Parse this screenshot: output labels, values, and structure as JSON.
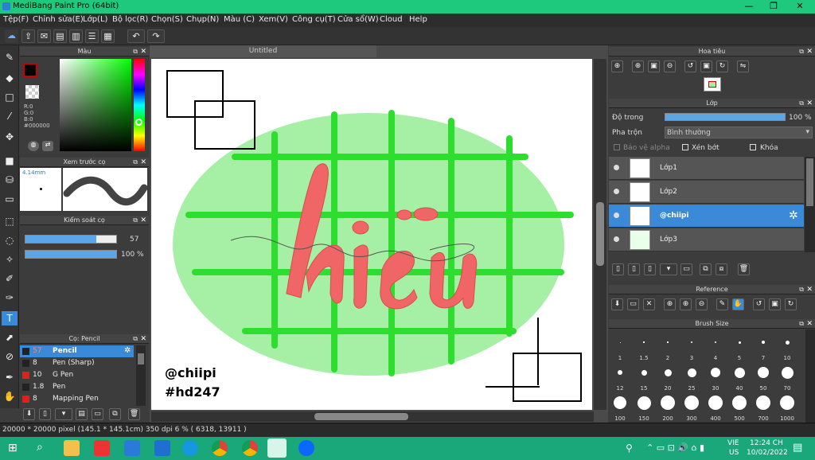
{
  "window": {
    "title": "MediBang Paint Pro (64bit)",
    "minimize": "—",
    "restore": "❐",
    "close": "✕"
  },
  "menu": [
    "Tệp(F)",
    "Chỉnh sửa(E)",
    "Lớp(L)",
    "Bộ lọc(R)",
    "Chọn(S)",
    "Chụp(N)",
    "Màu (C)",
    "Xem(V)",
    "Công cụ(T)",
    "Cửa sổ(W)",
    "Cloud",
    "Help"
  ],
  "color_panel": {
    "title": "Màu",
    "r": "R:0",
    "g": "G:0",
    "b": "B:0",
    "hex": "#000000",
    "primary": "#000000",
    "secondary": "#ff0000"
  },
  "preview_panel": {
    "title": "Xem trước cọ",
    "size": "4.14mm"
  },
  "brush_control": {
    "title": "Kiểm soát cọ",
    "size_value": "57",
    "opacity_value": "100 %",
    "size_fraction": 0.78,
    "opacity_fraction": 1.0
  },
  "brush_list": {
    "title": "Cọ: Pencil",
    "items": [
      {
        "size": "57",
        "name": "Pencil",
        "color": "#222222",
        "selected": true
      },
      {
        "size": "8",
        "name": "Pen (Sharp)",
        "color": "#222222",
        "selected": false
      },
      {
        "size": "10",
        "name": "G Pen",
        "color": "#e02020",
        "selected": false
      },
      {
        "size": "1.8",
        "name": "Pen",
        "color": "#222222",
        "selected": false
      },
      {
        "size": "8",
        "name": "Mapping Pen",
        "color": "#e02020",
        "selected": false
      }
    ]
  },
  "document": {
    "tab": "Untitled",
    "watermark_line1": "@chiipi",
    "watermark_line2": "#hd247"
  },
  "navigator": {
    "title": "Hoa tiêu"
  },
  "layer_panel": {
    "title": "Lớp",
    "opacity_label": "Độ trong",
    "opacity_value": "100 %",
    "blend_label": "Pha trộn",
    "blend_value": "Bình thường",
    "protect_alpha": "Bảo vệ alpha",
    "clipping": "Xén bớt",
    "lock": "Khóa",
    "layers": [
      {
        "name": "Lớp1",
        "selected": false
      },
      {
        "name": "Lớp2",
        "selected": false
      },
      {
        "name": "@chiipi",
        "selected": true
      },
      {
        "name": "Lớp3",
        "selected": false
      }
    ]
  },
  "reference_panel": {
    "title": "Reference"
  },
  "brush_size_panel": {
    "title": "Brush Size",
    "sizes": [
      "1",
      "1.5",
      "2",
      "3",
      "4",
      "5",
      "7",
      "10",
      "12",
      "15",
      "20",
      "25",
      "30",
      "40",
      "50",
      "70",
      "100",
      "150",
      "200",
      "300",
      "400",
      "500",
      "700",
      "1000"
    ]
  },
  "status": {
    "text": "20000 * 20000 pixel  (145.1 * 145.1cm)  350 dpi  6 %  ( 6318, 13911 )"
  },
  "taskbar": {
    "lang_top": "VIE",
    "lang_bottom": "US",
    "time": "12:24 CH",
    "date": "10/02/2022"
  }
}
